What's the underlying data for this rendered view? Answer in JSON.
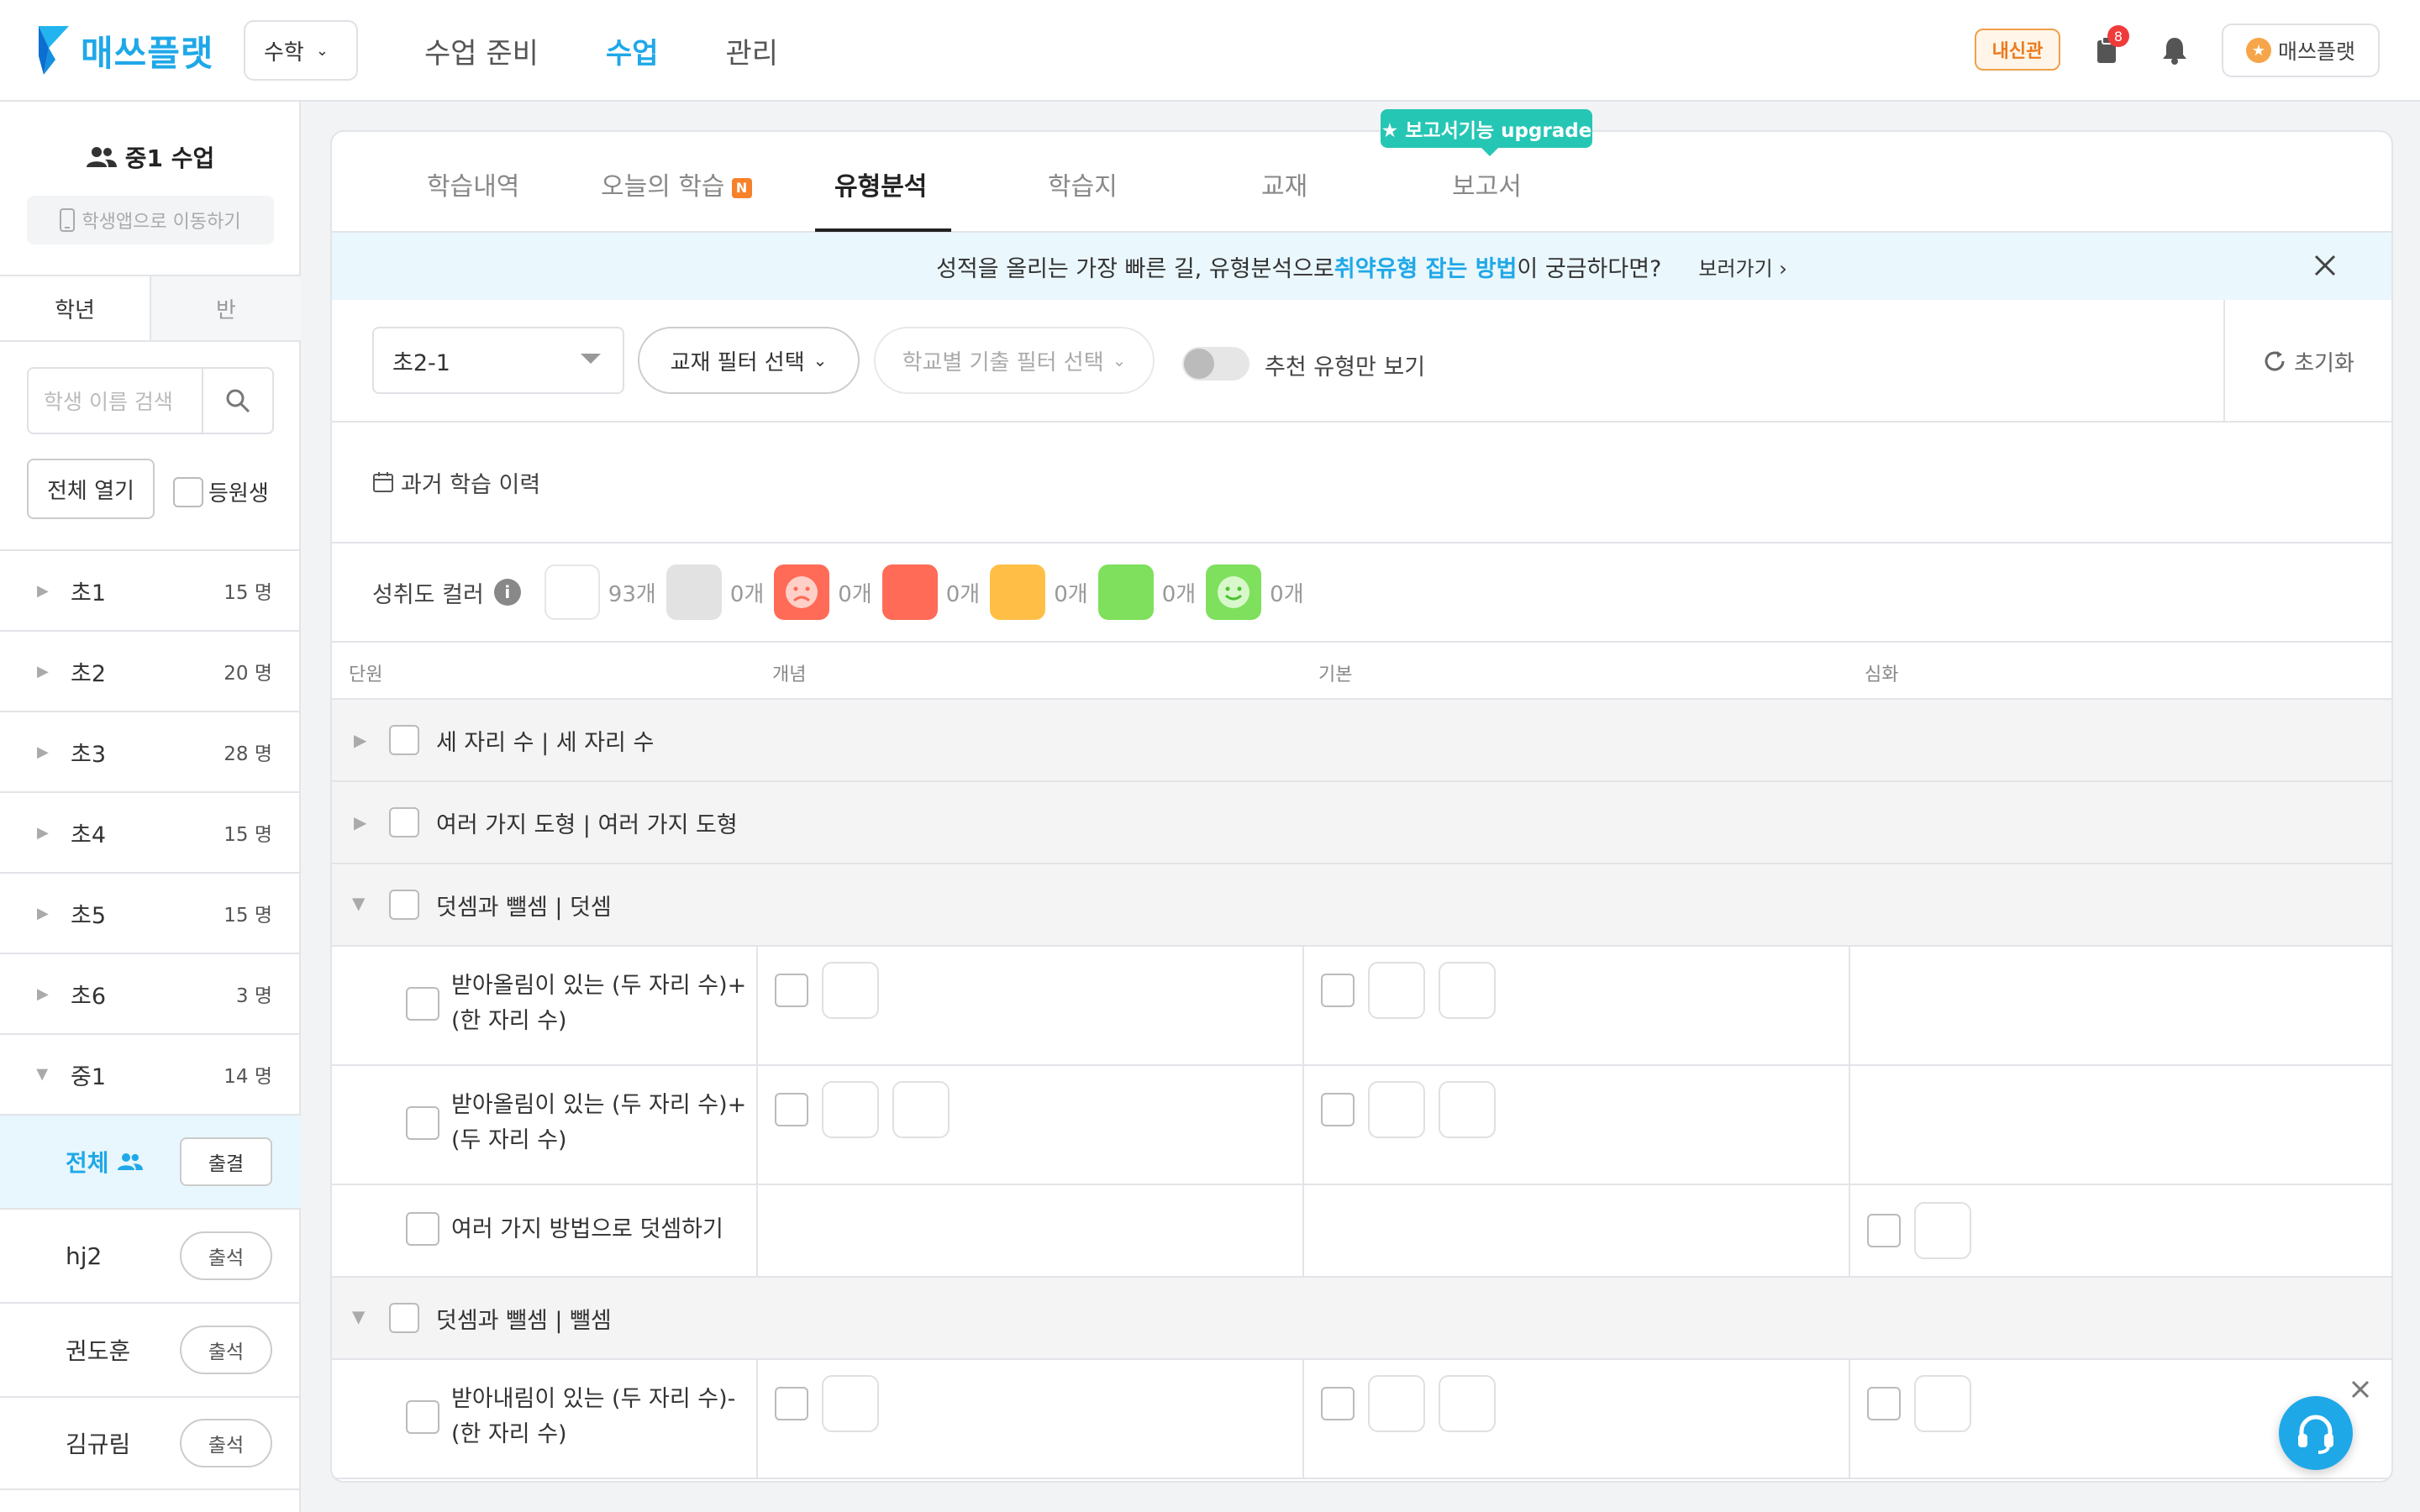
{
  "header": {
    "brand": "매쓰플랫",
    "subject": "수학",
    "nav": [
      "수업 준비",
      "수업",
      "관리"
    ],
    "nav_active": "수업",
    "badge": "내신관",
    "notification_count": "8",
    "profile": "매쓰플랫"
  },
  "sidebar": {
    "class_title": "중1 수업",
    "student_app": "학생앱으로 이동하기",
    "seg_grade": "학년",
    "seg_class": "반",
    "search_placeholder": "학생 이름 검색",
    "open_all": "전체 열기",
    "enrolled": "등원생",
    "grades": [
      {
        "name": "초1",
        "count": "15 명"
      },
      {
        "name": "초2",
        "count": "20 명"
      },
      {
        "name": "초3",
        "count": "28 명"
      },
      {
        "name": "초4",
        "count": "15 명"
      },
      {
        "name": "초5",
        "count": "15 명"
      },
      {
        "name": "초6",
        "count": "3 명"
      },
      {
        "name": "중1",
        "count": "14 명"
      }
    ],
    "all_label": "전체",
    "attend_all": "출결",
    "students": [
      {
        "name": "hj2",
        "btn": "출석"
      },
      {
        "name": "권도훈",
        "btn": "출석"
      },
      {
        "name": "김규림",
        "btn": "출석"
      }
    ]
  },
  "tabs": {
    "items": [
      "학습내역",
      "오늘의 학습",
      "유형분석",
      "학습지",
      "교재",
      "보고서"
    ],
    "new_badge": "N",
    "active": "유형분석",
    "upgrade": "★ 보고서기능 upgrade"
  },
  "banner": {
    "pre": "성적을 올리는 가장 빠른 길, 유형분석으로 ",
    "highlight": "취약유형 잡는 방법",
    "post": "이 궁금하다면?",
    "more": "보러가기 ›"
  },
  "filters": {
    "grade_select": "초2-1",
    "textbook": "교재 필터 선택",
    "school": "학교별 기출 필터 선택",
    "recommend": "추천 유형만 보기",
    "reset": "초기화"
  },
  "history": "과거 학습 이력",
  "legend": {
    "title": "성취도 컬러",
    "info": "i",
    "items": [
      {
        "color": "#ffffff",
        "count": "93개"
      },
      {
        "color": "#e2e2e2",
        "count": "0개"
      },
      {
        "color": "#ff6b57",
        "count": "0개"
      },
      {
        "color": "#ff6b57",
        "count": "0개"
      },
      {
        "color": "#ffbf47",
        "count": "0개"
      },
      {
        "color": "#7ee05c",
        "count": "0개"
      },
      {
        "color": "#7ee05c",
        "count": "0개"
      }
    ]
  },
  "columns": [
    "단원",
    "개념",
    "기본",
    "심화"
  ],
  "units": [
    {
      "label": "세 자리 수 | 세 자리 수"
    },
    {
      "label": "여러 가지 도형 | 여러 가지 도형"
    },
    {
      "label": "덧셈과 뺄셈 | 덧셈"
    },
    {
      "label": "덧셈과 뺄셈 | 뺄셈"
    }
  ],
  "topics": [
    {
      "line1": "받아올림이 있는 (두 자리 수)+",
      "line2": "(한 자리 수)"
    },
    {
      "line1": "받아올림이 있는 (두 자리 수)+",
      "line2": "(두 자리 수)"
    },
    {
      "line1": "여러 가지 방법으로 덧셈하기",
      "line2": ""
    },
    {
      "line1": "받아내림이 있는 (두 자리 수)-",
      "line2": "(한 자리 수)"
    }
  ]
}
